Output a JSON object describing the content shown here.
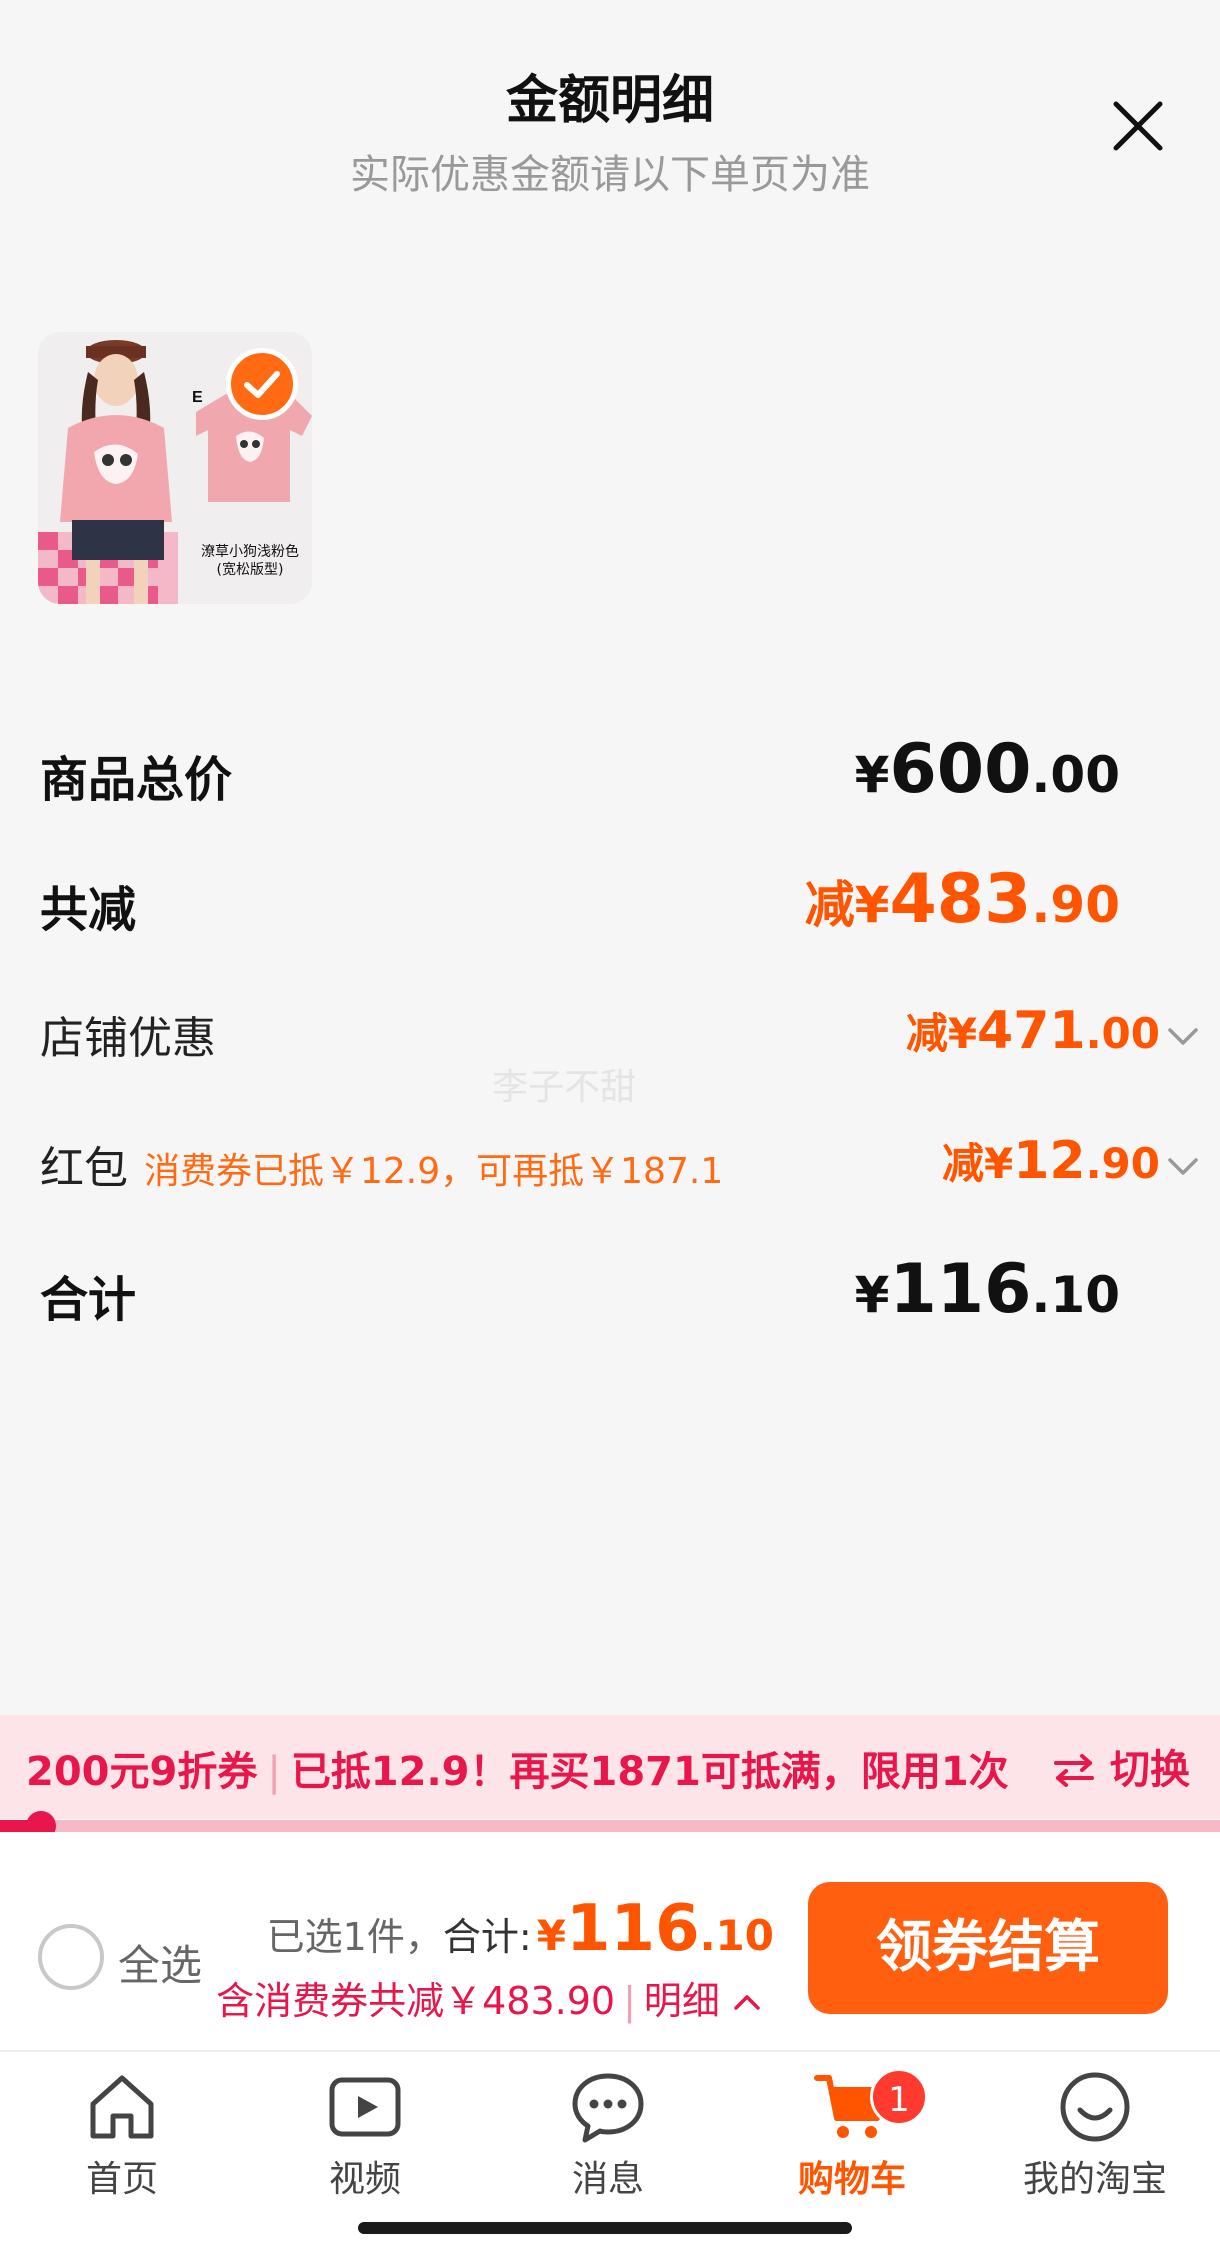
{
  "sheet": {
    "title": "金额明细",
    "subtitle": "实际优惠金额请以下单页为准",
    "product_caption_line1": "潦草小狗浅粉色",
    "product_caption_line2": "(宽松版型)",
    "watermark": "李子不甜"
  },
  "rows": {
    "total": {
      "label": "商品总价",
      "currency": "¥",
      "integer": "600",
      "decimal": ".00"
    },
    "reduction": {
      "label": "共减",
      "prefix": "减¥",
      "integer": "483",
      "decimal": ".90"
    },
    "shop": {
      "label": "店铺优惠",
      "prefix": "减¥",
      "integer": "471",
      "decimal": ".00"
    },
    "redpacket": {
      "label": "红包",
      "note": "消费券已抵￥12.9，可再抵￥187.1",
      "prefix": "减¥",
      "integer": "12",
      "decimal": ".90"
    },
    "sum": {
      "label": "合计",
      "currency": "¥",
      "integer": "116",
      "decimal": ".10"
    }
  },
  "banner": {
    "coupon": "200元9折券",
    "message": "已抵12.9！再买1871可抵满，限用1次",
    "switch_label": "切换",
    "progress": 0.034
  },
  "footer": {
    "select_all": "全选",
    "count": "已选1件，",
    "total_label": "合计:",
    "currency": "¥",
    "integer": "116",
    "decimal": ".10",
    "discount": "含消费券共减￥483.90",
    "detail": "明细",
    "checkout": "领券结算"
  },
  "tabs": [
    {
      "label": "首页",
      "icon": "home-icon"
    },
    {
      "label": "视频",
      "icon": "video-icon"
    },
    {
      "label": "消息",
      "icon": "message-icon"
    },
    {
      "label": "购物车",
      "icon": "cart-icon",
      "badge": "1",
      "active": true
    },
    {
      "label": "我的淘宝",
      "icon": "profile-icon"
    }
  ],
  "colors": {
    "accent": "#ff5500",
    "checkout": "#ff5f0f",
    "banner_text": "#e8164a",
    "banner_bg": "#fde4e8"
  }
}
